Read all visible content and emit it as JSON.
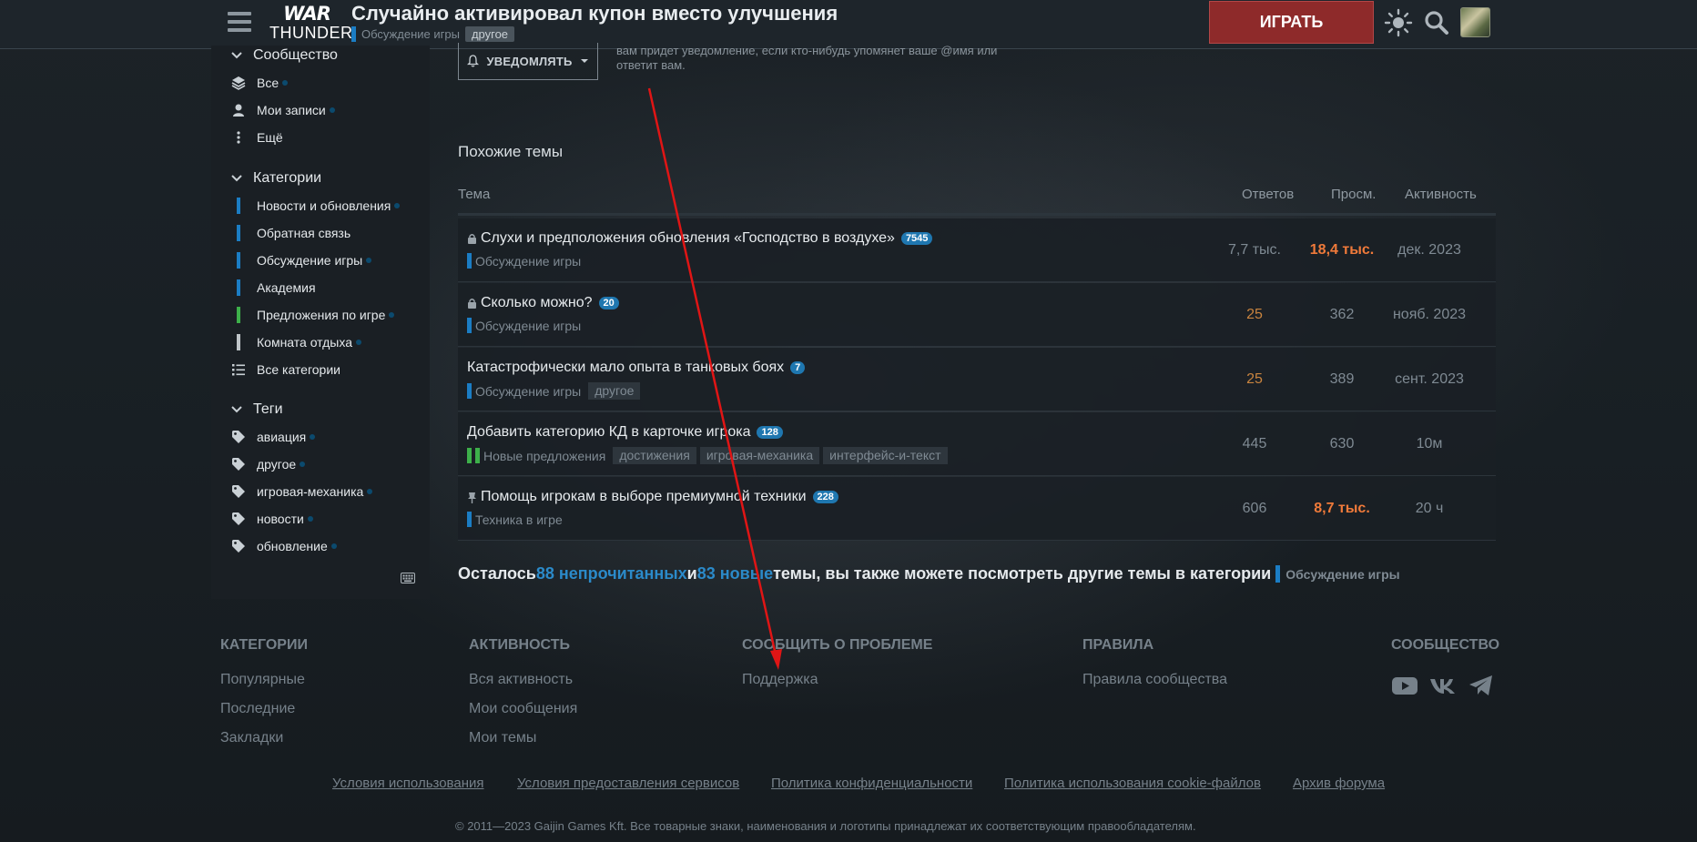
{
  "header": {
    "logo_top": "WAR",
    "logo_bottom": "THUNDER",
    "topic_title": "Случайно активировал купон вместо улучшения",
    "topic_category": "Обсуждение игры",
    "topic_tag": "другое",
    "play_label": "ИГРАТЬ",
    "icons": [
      "menu-icon",
      "theme-toggle-icon",
      "search-icon",
      "avatar"
    ]
  },
  "sidebar": {
    "community_label": "Сообщество",
    "community_items": [
      {
        "label": "Все",
        "icon": "stack-icon"
      },
      {
        "label": "Мои записи",
        "icon": "user-icon"
      },
      {
        "label": "Ещё",
        "icon": "more-vertical-icon"
      }
    ],
    "categories_label": "Категории",
    "category_items": [
      {
        "label": "Новости и обновления",
        "color": "#1b7dc4"
      },
      {
        "label": "Обратная связь",
        "color": "#1b7dc4"
      },
      {
        "label": "Обсуждение игры",
        "color": "#1b7dc4"
      },
      {
        "label": "Академия",
        "color": "#1b7dc4"
      },
      {
        "label": "Предложения по игре",
        "color": "#3db04a"
      },
      {
        "label": "Комната отдыха",
        "color": "#bfc5c9"
      },
      {
        "label": "Все категории",
        "icon": "list-icon"
      }
    ],
    "tags_label": "Теги",
    "tag_items": [
      "авиация",
      "другое",
      "игровая-механика",
      "новости",
      "обновление"
    ]
  },
  "notify": {
    "button_label": "УВЕДОМЛЯТЬ",
    "description": "вам придет уведомление, если кто-нибудь упомянет ваше @имя или ответит вам."
  },
  "similar": {
    "title": "Похожие темы",
    "columns": [
      "Тема",
      "Ответов",
      "Просм.",
      "Активность"
    ],
    "rows": [
      {
        "title": "Слухи и предположения обновления «Господство в воздухе»",
        "badge": "7545",
        "locked": true,
        "pinned": false,
        "category": "Обсуждение игры",
        "cat_color": "#1b7dc4",
        "tags": [],
        "replies": "7,7 тыс.",
        "views": "18,4 тыс.",
        "activity": "дек. 2023",
        "replies_color": "#7f8a93",
        "views_color": "#f07a3a"
      },
      {
        "title": "Сколько можно?",
        "badge": "20",
        "locked": true,
        "pinned": false,
        "category": "Обсуждение игры",
        "cat_color": "#1b7dc4",
        "tags": [],
        "replies": "25",
        "views": "362",
        "activity": "нояб. 2023",
        "replies_color": "#c9843f",
        "views_color": "#7f8a93"
      },
      {
        "title": "Катастрофически мало опыта в танковых боях",
        "badge": "7",
        "locked": false,
        "pinned": false,
        "category": "Обсуждение игры",
        "cat_color": "#1b7dc4",
        "tags": [
          "другое"
        ],
        "replies": "25",
        "views": "389",
        "activity": "сент. 2023",
        "replies_color": "#c9843f",
        "views_color": "#7f8a93"
      },
      {
        "title": "Добавить категорию КД в карточке игрока",
        "badge": "128",
        "locked": false,
        "pinned": false,
        "category": "Новые предложения",
        "cat_color": "#3db04a",
        "tags": [
          "достижения",
          "игровая-механика",
          "интерфейс-и-текст"
        ],
        "replies": "445",
        "views": "630",
        "activity": "10м",
        "replies_color": "#7f8a93",
        "views_color": "#7f8a93"
      },
      {
        "title": "Помощь игрокам в выборе премиумной техники",
        "badge": "228",
        "locked": false,
        "pinned": true,
        "category": "Техника в игре",
        "cat_color": "#1b7dc4",
        "tags": [],
        "replies": "606",
        "views": "8,7 тыс.",
        "activity": "20 ч",
        "replies_color": "#7f8a93",
        "views_color": "#f07a3a"
      }
    ]
  },
  "remaining": {
    "prefix": "Осталось ",
    "unread": "88 непрочитанных",
    "and": " и ",
    "new": "83 новые",
    "suffix": " темы, вы также можете посмотреть другие темы в категории",
    "category": "Обсуждение игры"
  },
  "footer": {
    "categories_head": "КАТЕГОРИИ",
    "categories_links": [
      "Популярные",
      "Последние",
      "Закладки"
    ],
    "activity_head": "АКТИВНОСТЬ",
    "activity_links": [
      "Вся активность",
      "Мои сообщения",
      "Мои темы"
    ],
    "report_head": "СООБЩИТЬ О ПРОБЛЕМЕ",
    "report_links": [
      "Поддержка"
    ],
    "rules_head": "ПРАВИЛА",
    "rules_links": [
      "Правила сообщества"
    ],
    "community_head": "СООБЩЕСТВО",
    "social_icons": [
      "youtube-icon",
      "vk-icon",
      "telegram-icon"
    ],
    "legal_links": [
      "Условия использования",
      "Условия предоставления сервисов",
      "Политика конфиденциальности",
      "Политика использования cookie-файлов",
      "Архив форума"
    ],
    "copyright": "© 2011—2023 Gaijin Games Kft. Все товарные знаки, наименования и логотипы принадлежат их соответствующим правообладателям."
  },
  "colors": {
    "accent_blue": "#1b7dc4",
    "link_blue": "#2b8ac9",
    "play_red": "#8e2a2a",
    "hot_orange": "#f07a3a",
    "annotation_red": "#e01515"
  }
}
